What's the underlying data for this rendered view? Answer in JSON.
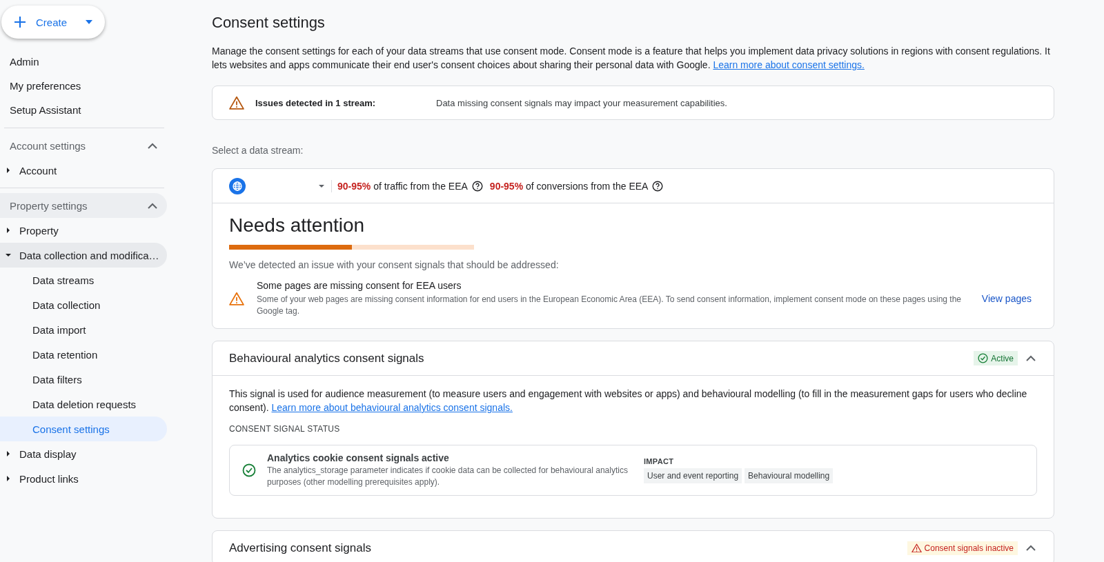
{
  "sidebar": {
    "create_button": {
      "label": "Create"
    },
    "links": [
      {
        "label": "Admin"
      },
      {
        "label": "My preferences"
      },
      {
        "label": "Setup Assistant"
      }
    ],
    "sections": [
      {
        "title": "Account settings",
        "expanded": true,
        "hovered": false,
        "items": [
          {
            "label": "Account",
            "expanded": false,
            "selected": false
          }
        ]
      },
      {
        "title": "Property settings",
        "expanded": true,
        "hovered": true,
        "items": [
          {
            "label": "Property",
            "expanded": false,
            "selected": false
          },
          {
            "label": "Data collection and modifica…",
            "expanded": true,
            "selected": false,
            "children": [
              {
                "label": "Data streams",
                "selected": false
              },
              {
                "label": "Data collection",
                "selected": false
              },
              {
                "label": "Data import",
                "selected": false
              },
              {
                "label": "Data retention",
                "selected": false
              },
              {
                "label": "Data filters",
                "selected": false
              },
              {
                "label": "Data deletion requests",
                "selected": false
              },
              {
                "label": "Consent settings",
                "selected": true
              }
            ]
          },
          {
            "label": "Data display",
            "expanded": false,
            "selected": false
          },
          {
            "label": "Product links",
            "expanded": false,
            "selected": false
          }
        ]
      }
    ]
  },
  "main": {
    "title": "Consent settings",
    "intro": "Manage the consent settings for each of your data streams that use consent mode. Consent mode is a feature that helps you implement data privacy solutions in regions with consent regulations. It lets websites and apps communicate their end user's consent choices about sharing their personal data with Google.",
    "intro_link": "Learn more about consent settings.",
    "alert": {
      "title": "Issues detected in 1 stream:",
      "message": "Data missing consent signals may impact your measurement capabilities."
    },
    "select_label": "Select a data stream:",
    "stream": {
      "stats": [
        {
          "value": "90-95%",
          "label": "of traffic from the EEA"
        },
        {
          "value": "90-95%",
          "label": "of conversions from the EEA"
        }
      ],
      "status": {
        "title": "Needs attention",
        "level": 0.5,
        "subtitle": "We’ve detected an issue with your consent signals that should be addressed:"
      },
      "issue": {
        "title": "Some pages are missing consent for EEA users",
        "body": "Some of your web pages are missing consent information for end users in the European Economic Area (EEA). To send consent information, implement consent mode on these pages using the Google tag.",
        "action": "View pages"
      }
    },
    "signal_sections": [
      {
        "title": "Behavioural analytics consent signals",
        "kind": "active",
        "badge": "Active",
        "expanded": true,
        "description": "This signal is used for audience measurement (to measure users and engagement with websites or apps) and behavioural modelling (to fill in the measurement gaps for users who decline consent).",
        "link": "Learn more about behavioural analytics consent signals.",
        "status_heading": "CONSENT SIGNAL STATUS",
        "signals": [
          {
            "kind": "active",
            "title": "Analytics cookie consent signals active",
            "body": "The analytics_storage parameter indicates if cookie data can be collected for behavioural analytics purposes (other modelling prerequisites apply).",
            "impact_heading": "IMPACT",
            "impacts": [
              "User and event reporting",
              "Behavioural modelling"
            ]
          }
        ]
      },
      {
        "title": "Advertising consent signals",
        "kind": "inactive",
        "badge": "Consent signals inactive",
        "expanded": true
      }
    ]
  }
}
